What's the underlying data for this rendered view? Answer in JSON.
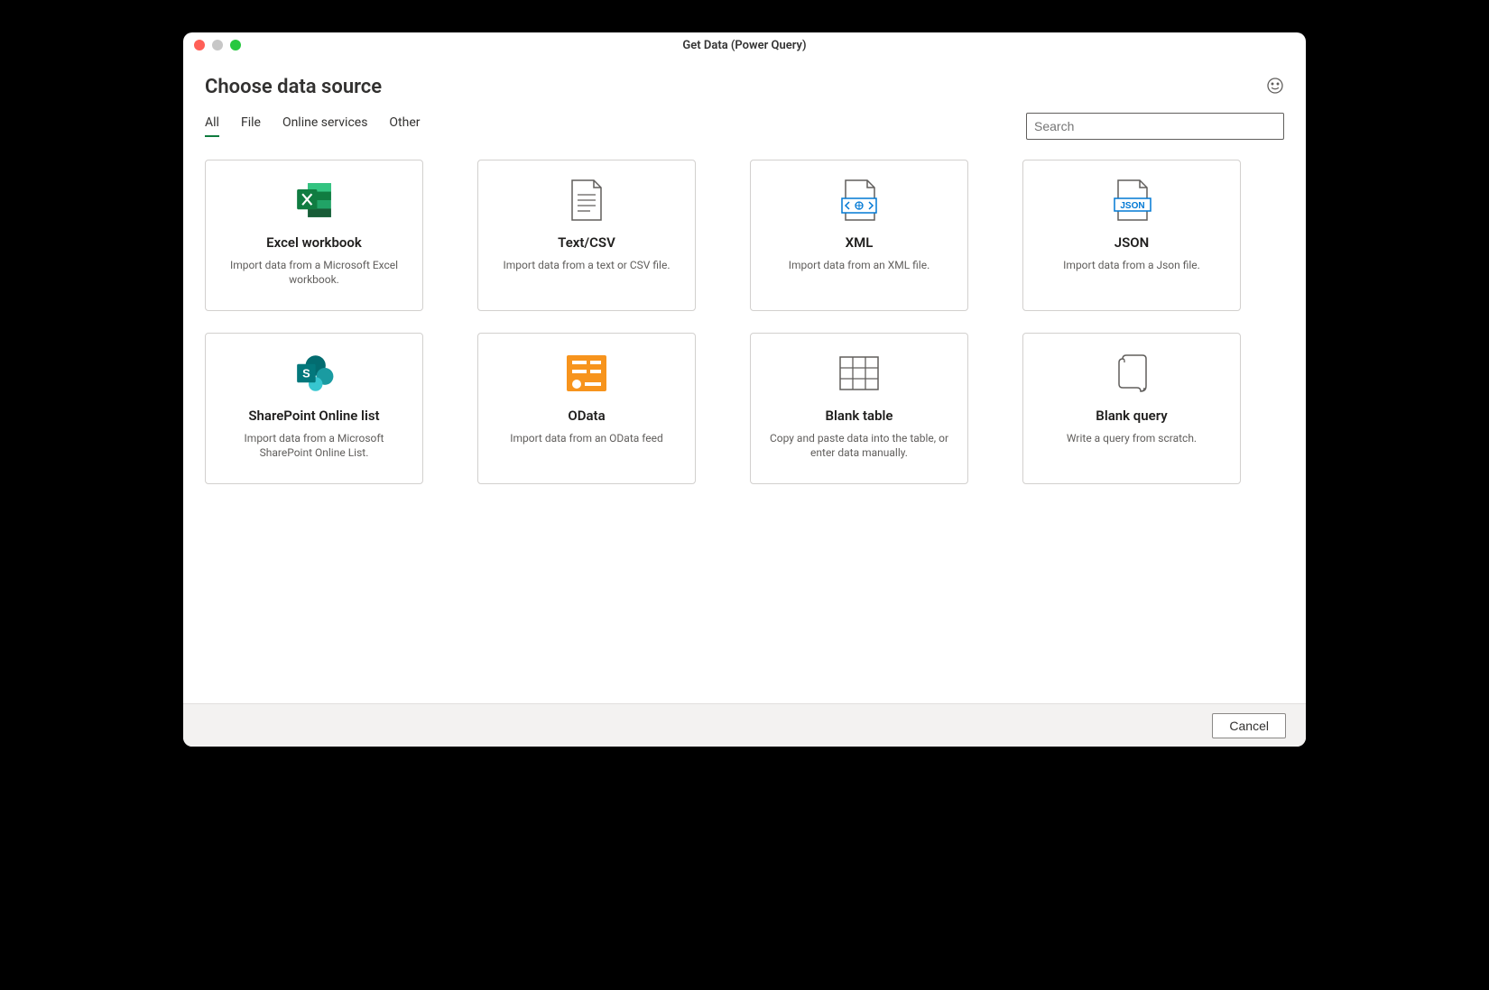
{
  "window": {
    "title": "Get Data (Power Query)"
  },
  "header": {
    "title": "Choose data source"
  },
  "tabs": [
    {
      "id": "all",
      "label": "All",
      "active": true
    },
    {
      "id": "file",
      "label": "File",
      "active": false
    },
    {
      "id": "online",
      "label": "Online services",
      "active": false
    },
    {
      "id": "other",
      "label": "Other",
      "active": false
    }
  ],
  "search": {
    "placeholder": "Search",
    "value": ""
  },
  "sources": [
    {
      "id": "excel",
      "title": "Excel workbook",
      "desc": "Import data from a Microsoft Excel workbook.",
      "icon": "excel"
    },
    {
      "id": "textcsv",
      "title": "Text/CSV",
      "desc": "Import data from a text or CSV file.",
      "icon": "textcsv"
    },
    {
      "id": "xml",
      "title": "XML",
      "desc": "Import data from an XML file.",
      "icon": "xml"
    },
    {
      "id": "json",
      "title": "JSON",
      "desc": "Import data from a Json file.",
      "icon": "json"
    },
    {
      "id": "sharepoint",
      "title": "SharePoint Online list",
      "desc": "Import data from a Microsoft SharePoint Online List.",
      "icon": "sharepoint"
    },
    {
      "id": "odata",
      "title": "OData",
      "desc": "Import data from an OData feed",
      "icon": "odata"
    },
    {
      "id": "blanktable",
      "title": "Blank table",
      "desc": "Copy and paste data into the table, or enter data manually.",
      "icon": "blanktable"
    },
    {
      "id": "blankquery",
      "title": "Blank query",
      "desc": "Write a query from scratch.",
      "icon": "blankquery"
    }
  ],
  "footer": {
    "cancel_label": "Cancel"
  }
}
